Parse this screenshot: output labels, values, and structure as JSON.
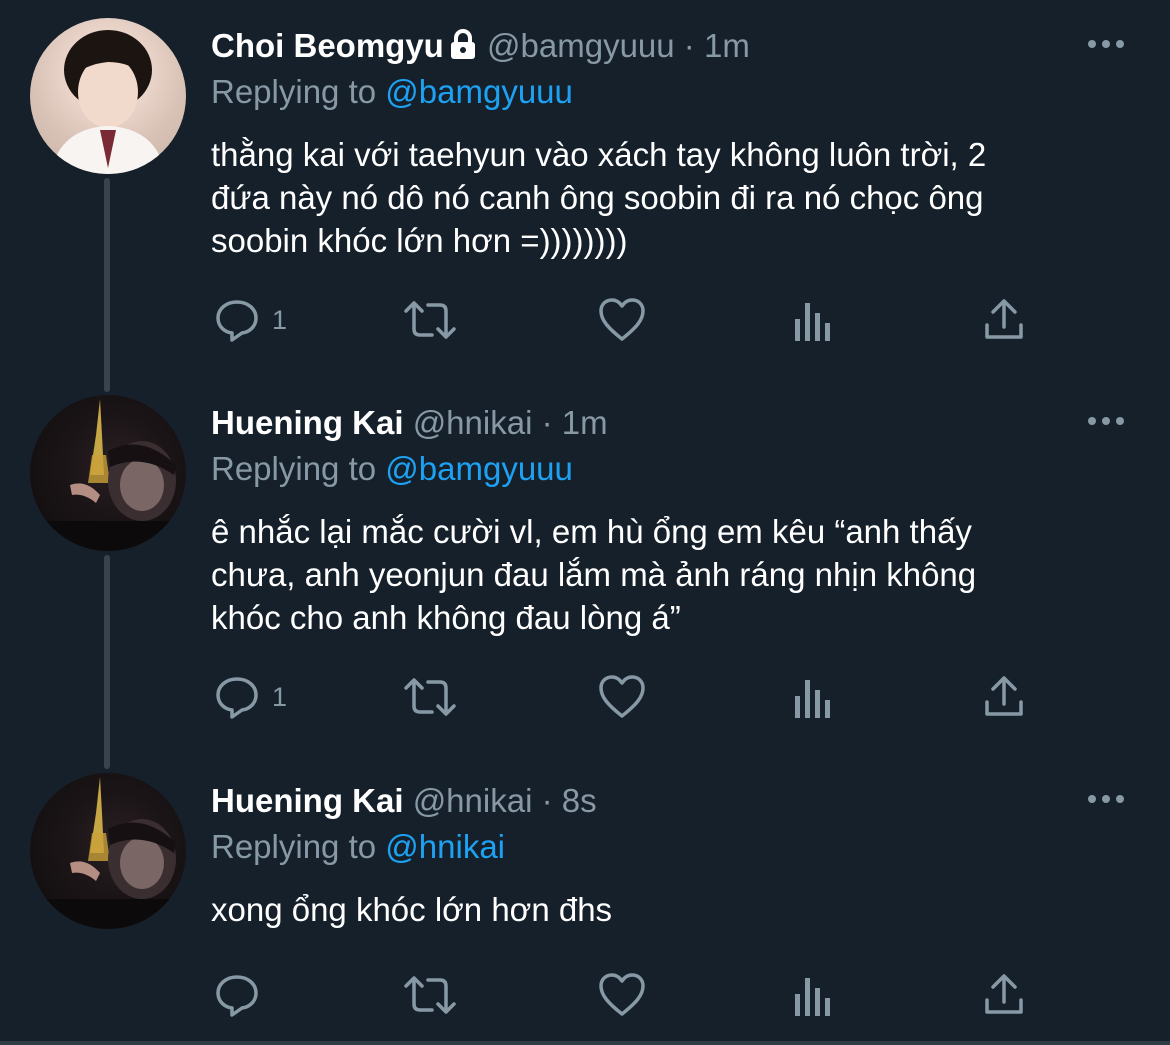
{
  "tweets": [
    {
      "name": "Choi Beomgyu",
      "locked": true,
      "handle": "@bamgyuuu",
      "dot": "·",
      "time": "1m",
      "replying_prefix": "Replying to",
      "replying_to": "@bamgyuuu",
      "lines": [
        "thằng kai với taehyun vào xách tay không luôn trời, 2",
        "đứa này nó dô nó canh ông soobin đi ra nó chọc ông",
        "soobin khóc lớn hơn =))))))))"
      ],
      "reply_count": "1",
      "avatar_style": "light"
    },
    {
      "name": "Huening Kai",
      "locked": false,
      "handle": "@hnikai",
      "dot": "·",
      "time": "1m",
      "replying_prefix": "Replying to",
      "replying_to": "@bamgyuuu",
      "lines": [
        "ê nhắc lại mắc cười vl, em hù ổng em kêu “anh thấy",
        "chưa, anh yeonjun đau lắm mà ảnh ráng nhịn không",
        "khóc cho anh không đau lòng á”"
      ],
      "reply_count": "1",
      "avatar_style": "dark"
    },
    {
      "name": "Huening Kai",
      "locked": false,
      "handle": "@hnikai",
      "dot": "·",
      "time": "8s",
      "replying_prefix": "Replying to",
      "replying_to": "@hnikai",
      "lines": [
        "xong ổng khóc lớn hơn đhs"
      ],
      "reply_count": "",
      "avatar_style": "dark"
    }
  ],
  "icons": {
    "reply": "reply-icon",
    "retweet": "retweet-icon",
    "like": "like-icon",
    "analytics": "analytics-icon",
    "share": "share-icon",
    "more": "more-icon",
    "lock": "lock-icon"
  },
  "colors": {
    "background": "#15202b",
    "text_primary": "#ffffff",
    "text_secondary": "#8899a6",
    "link": "#1da1f2",
    "thread_line": "#38444d"
  }
}
